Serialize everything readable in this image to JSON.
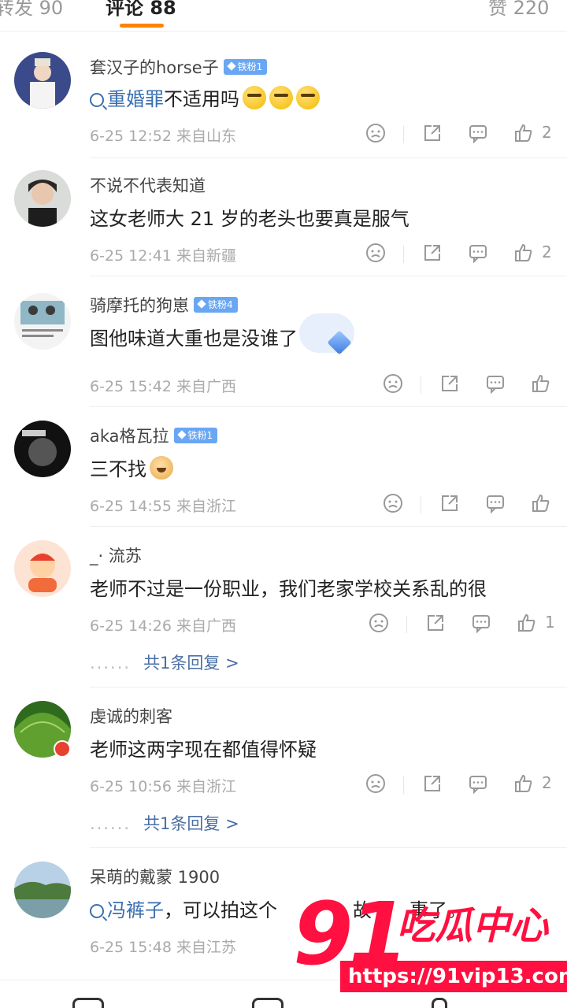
{
  "tabs": [
    {
      "label": "转发 90",
      "active": false
    },
    {
      "label": "评论 88",
      "active": true
    },
    {
      "label": "赞 220",
      "active": false
    }
  ],
  "accent_color": "#ff8200",
  "comments": [
    {
      "username": "套汉子的horse子",
      "badge": "铁粉1",
      "text_link": "重婚罪",
      "text": "不适用吗",
      "emojis": 3,
      "meta": "6-25 12:52  来自山东",
      "likes": "2"
    },
    {
      "username": "不说不代表知道",
      "badge": "",
      "text": "这女老师大 21 岁的老头也要真是服气",
      "meta": "6-25 12:41  来自新疆",
      "likes": "2"
    },
    {
      "username": "骑摩托的狗崽",
      "badge": "铁粉4",
      "text": "图他味道大重也是没谁了",
      "meta": "6-25 15:42  来自广西",
      "likes": ""
    },
    {
      "username": "aka格瓦拉",
      "badge": "铁粉1",
      "text": "三不找",
      "meta": "6-25 14:55  来自浙江",
      "likes": ""
    },
    {
      "username": "_· 流苏",
      "badge": "",
      "text": "老师不过是一份职业，我们老家学校关系乱的很",
      "meta": "6-25 14:26  来自广西",
      "likes": "1",
      "reply": "共1条回复 >"
    },
    {
      "username": "虔诚的刺客",
      "badge": "",
      "text": "老师这两字现在都值得怀疑",
      "meta": "6-25 10:56  来自浙江",
      "likes": "2",
      "reply": "共1条回复 >"
    },
    {
      "username": "呆萌的戴蒙 1900",
      "badge": "",
      "text_link": "冯裤子",
      "text": "，可以拍这个",
      "text_tail": "故",
      "text_tail2": "事了。",
      "meta": "6-25 15:48  来自江苏",
      "likes": ""
    }
  ],
  "reply_dots": "......",
  "watermark": {
    "number": "91",
    "chinese": "吃瓜中心",
    "url": "https://91vip13.com"
  }
}
